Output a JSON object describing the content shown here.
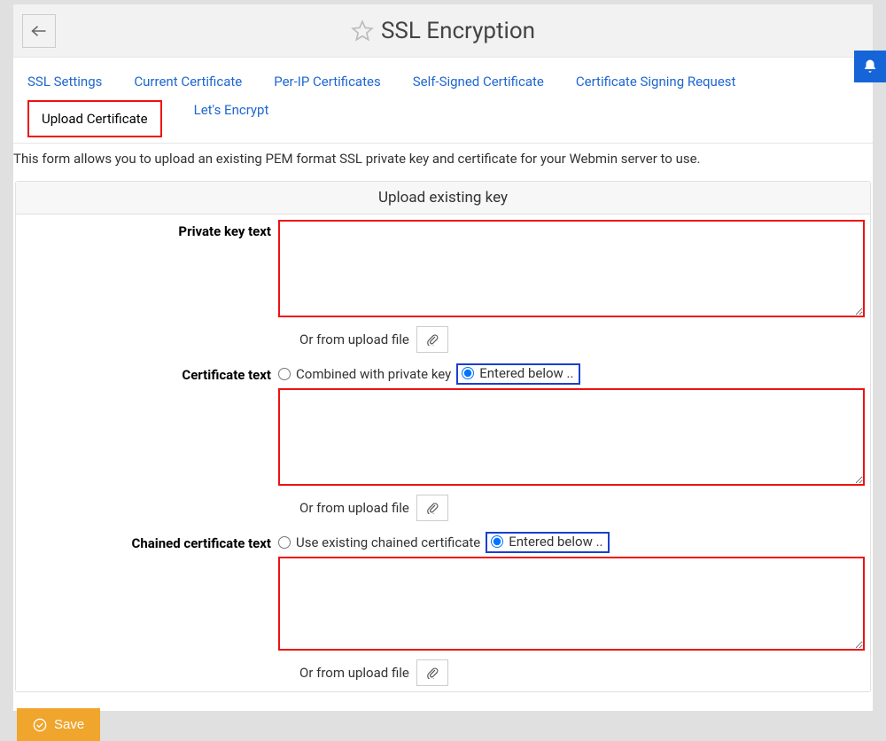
{
  "header": {
    "title": "SSL Encryption"
  },
  "tabs": {
    "ssl_settings": "SSL Settings",
    "current_certificate": "Current Certificate",
    "per_ip_certificates": "Per-IP Certificates",
    "self_signed_certificate": "Self-Signed Certificate",
    "certificate_signing_request": "Certificate Signing Request",
    "upload_certificate": "Upload Certificate",
    "lets_encrypt": "Let's Encrypt"
  },
  "description": "This form allows you to upload an existing PEM format SSL private key and certificate for your Webmin server to use.",
  "panel": {
    "title": "Upload existing key"
  },
  "form": {
    "private_key": {
      "label": "Private key text",
      "value": "",
      "or_upload": "Or from upload file"
    },
    "certificate": {
      "label": "Certificate text",
      "radio_combined": "Combined with private key",
      "radio_entered": "Entered below ..",
      "value": "",
      "or_upload": "Or from upload file"
    },
    "chained": {
      "label": "Chained certificate text",
      "radio_existing": "Use existing chained certificate",
      "radio_entered": "Entered below ..",
      "value": "",
      "or_upload": "Or from upload file"
    }
  },
  "buttons": {
    "save": "Save"
  }
}
